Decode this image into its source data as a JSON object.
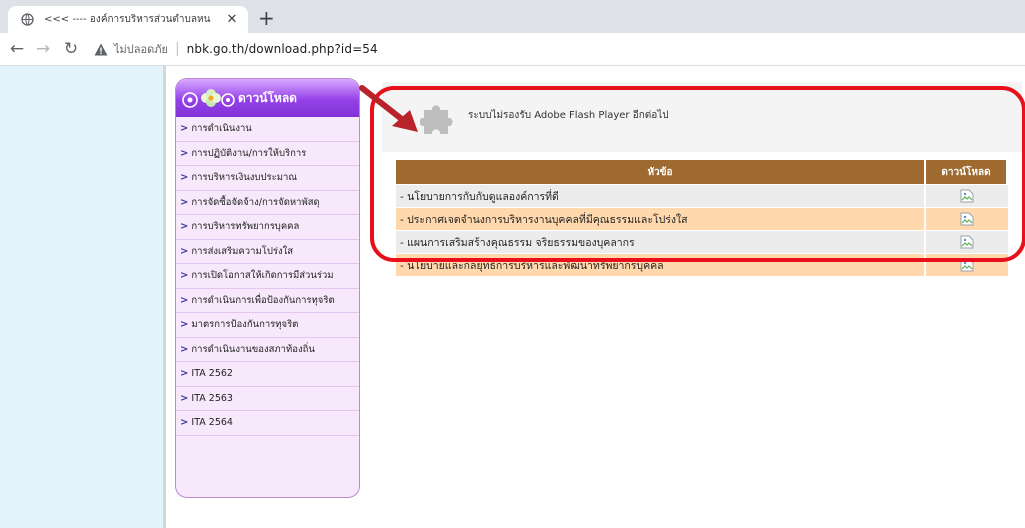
{
  "browser": {
    "tab_title": "<<< ---- องค์การบริหารส่วนตำบลหน",
    "security_label": "ไม่ปลอดภัย",
    "url": "nbk.go.th/download.php?id=54"
  },
  "sidebar": {
    "header": "ดาวน์โหลด",
    "items": [
      {
        "label": "การดำเนินงาน"
      },
      {
        "label": "การปฏิบัติงาน/การให้บริการ"
      },
      {
        "label": "การบริหารเงินงบประมาณ"
      },
      {
        "label": "การจัดซื้อจัดจ้าง/การจัดหาพัสดุ"
      },
      {
        "label": "การบริหารทรัพยากรบุคคล"
      },
      {
        "label": "การส่งเสริมความโปร่งใส"
      },
      {
        "label": "การเปิดโอกาสให้เกิดการมีส่วนร่วม"
      },
      {
        "label": "การดำเนินการเพื่อป้องกันการทุจริต"
      },
      {
        "label": "มาตรการป้องกันการทุจริต"
      },
      {
        "label": "การดำเนินงานของสภาท้องถิ่น"
      },
      {
        "label": "ITA 2562"
      },
      {
        "label": "ITA 2563"
      },
      {
        "label": "ITA 2564"
      }
    ]
  },
  "flash": {
    "message": "ระบบไม่รองรับ Adobe Flash Player อีกต่อไป"
  },
  "table": {
    "headers": {
      "title": "หัวข้อ",
      "download": "ดาวน์โหลด"
    },
    "rows": [
      {
        "title": "- นโยบายการกับกับดูแลองค์การที่ดี"
      },
      {
        "title": "- ประกาศเจตจำนงการบริหารงานบุคคลที่มีคุณธรรมและโปร่งใส"
      },
      {
        "title": "- แผนการเสริมสร้างคุณธรรม จริยธรรมของบุคลากร"
      },
      {
        "title": "- นโยบายและกลยุทธ์การบริหารและพัฒนาทรัพยากรบุคคล"
      }
    ]
  },
  "colors": {
    "annotation": "#e8101c",
    "header_brown": "#9e6a2f",
    "row_peach": "#ffd9ad",
    "sidebar_purple": "#9442e8"
  }
}
